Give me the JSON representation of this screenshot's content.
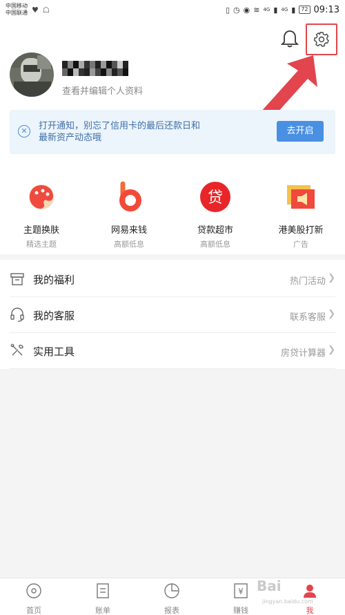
{
  "status_bar": {
    "carrier1": "中国移动",
    "carrier2": "中国联通",
    "signal1": "4G",
    "signal2": "4G",
    "battery": "72",
    "time": "09:13"
  },
  "profile": {
    "edit_link": "查看并编辑个人资料"
  },
  "notice": {
    "text": "打开通知，别忘了信用卡的最后还款日和最新资产动态哦",
    "button": "去开启"
  },
  "features": [
    {
      "title": "主题换肤",
      "subtitle": "精选主题",
      "icon": "palette-icon"
    },
    {
      "title": "网易来钱",
      "subtitle": "高额低息",
      "icon": "wangyi-laiqian-icon"
    },
    {
      "title": "贷款超市",
      "subtitle": "高额低息",
      "icon": "loan-market-icon"
    },
    {
      "title": "港美股打新",
      "subtitle": "广告",
      "icon": "megaphone-icon"
    }
  ],
  "menu": [
    {
      "label": "我的福利",
      "right": "热门活动",
      "icon": "gift-box-icon"
    },
    {
      "label": "我的客服",
      "right": "联系客服",
      "icon": "headset-icon"
    },
    {
      "label": "实用工具",
      "right": "房贷计算器",
      "icon": "tools-icon"
    }
  ],
  "tabs": [
    {
      "label": "首页",
      "icon": "home-icon"
    },
    {
      "label": "账单",
      "icon": "bill-icon"
    },
    {
      "label": "报表",
      "icon": "chart-icon"
    },
    {
      "label": "赚钱",
      "icon": "money-icon"
    },
    {
      "label": "我",
      "icon": "user-icon"
    }
  ],
  "watermark": {
    "brand": "Bai",
    "url": "jingyan.baidu.com"
  },
  "colors": {
    "accent": "#e2454d",
    "primary": "#4a90e2",
    "notice_bg": "#ecf4fc"
  }
}
